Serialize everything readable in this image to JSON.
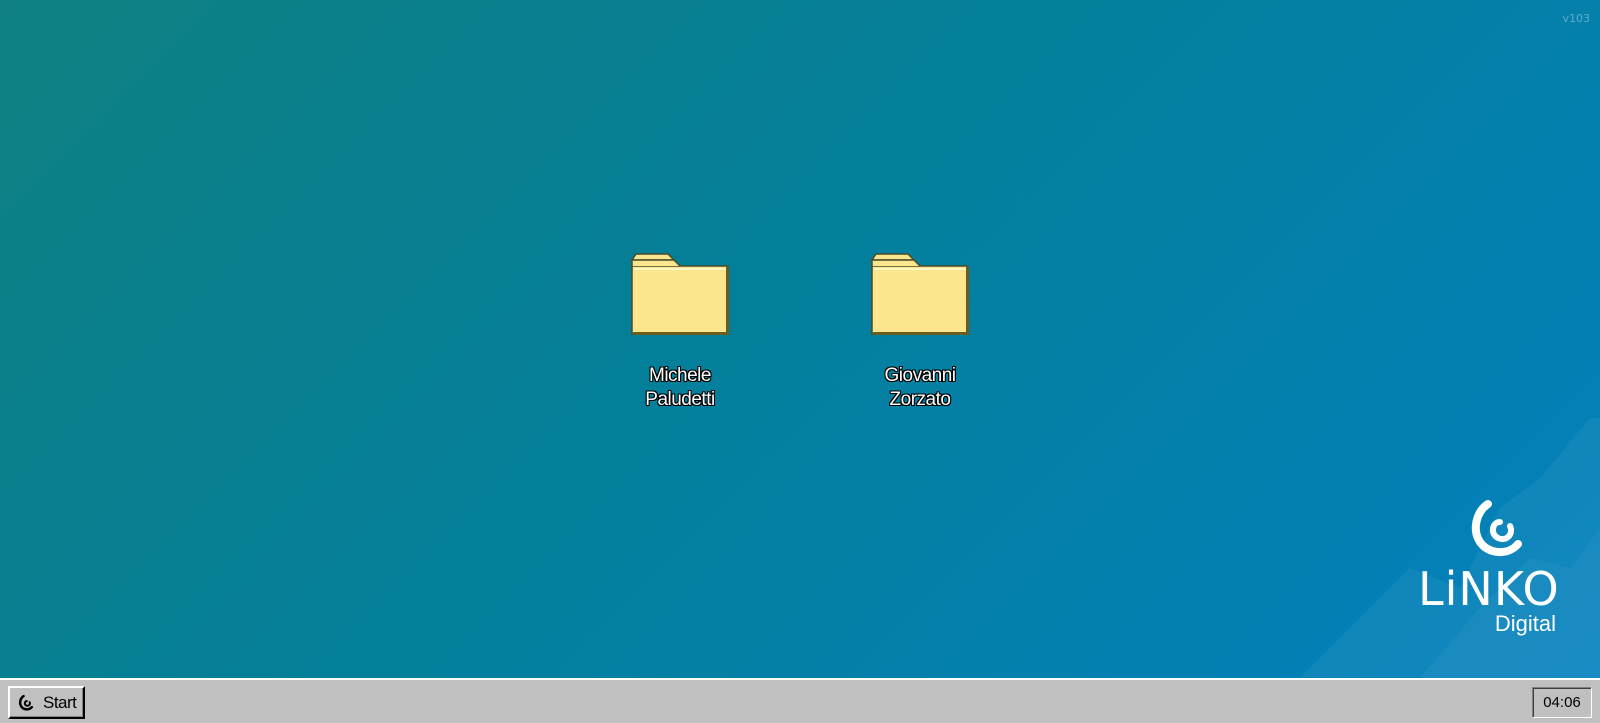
{
  "desktop": {
    "version": "v103",
    "icons": [
      {
        "label": "Michele\nPaludetti",
        "icon": "folder-icon"
      },
      {
        "label": "Giovanni\nZorzato",
        "icon": "folder-icon"
      }
    ],
    "logo": {
      "brand": "LiNKO",
      "sub": "Digital"
    }
  },
  "taskbar": {
    "start_label": "Start",
    "clock": "04:06"
  },
  "colors": {
    "desktop_start": "#0f8182",
    "desktop_end": "#0481bf",
    "folder": "#fbe68e",
    "taskbar": "#c0c0c0"
  }
}
